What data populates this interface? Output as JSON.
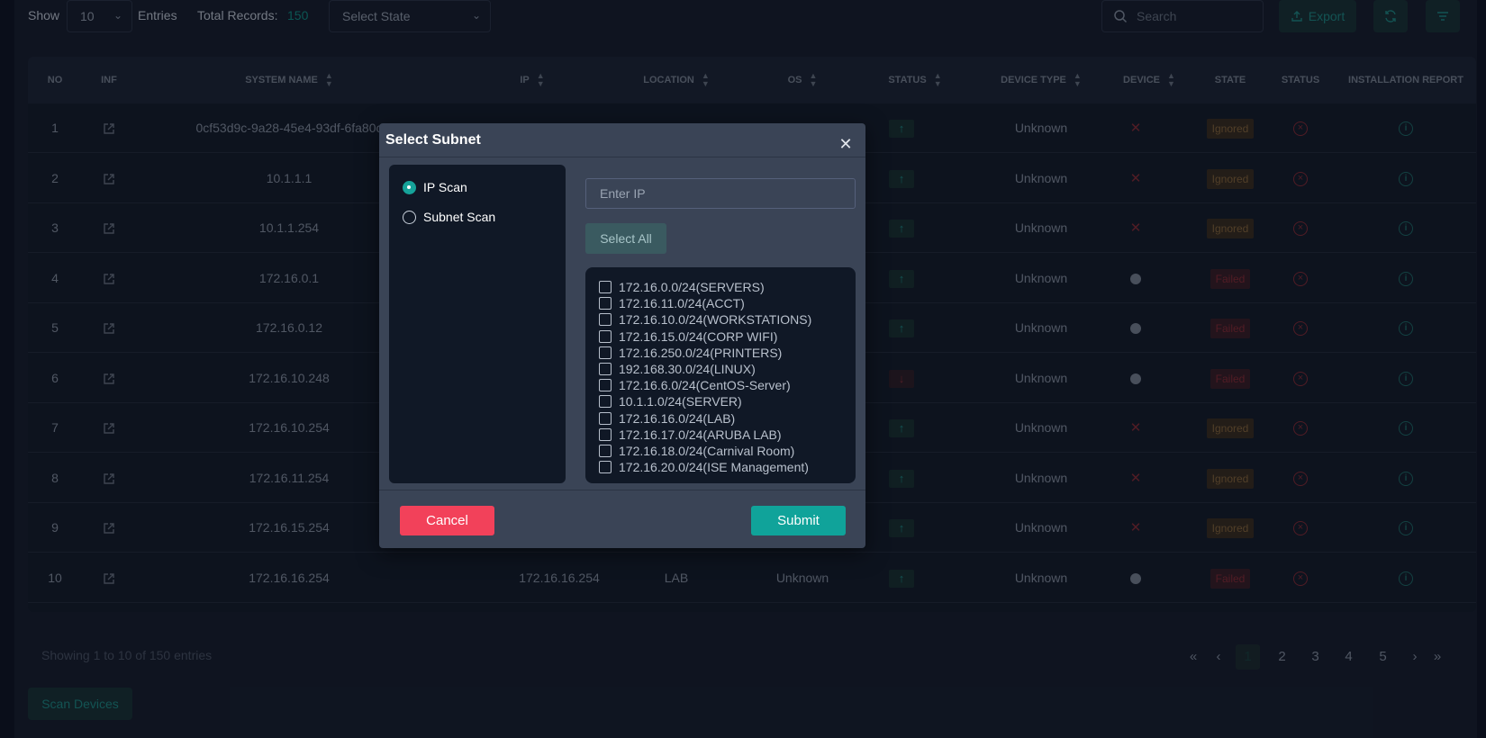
{
  "toolbar": {
    "show_label": "Show",
    "page_size": "10",
    "entries_label": "Entries",
    "total_label": "Total Records:",
    "total_value": "150",
    "state_placeholder": "Select State",
    "search_placeholder": "Search",
    "export_label": "Export",
    "icons": [
      "search-icon",
      "upload-icon",
      "refresh-icon",
      "filter-icon"
    ]
  },
  "table": {
    "columns": [
      "NO",
      "INF",
      "SYSTEM NAME",
      "IP",
      "LOCATION",
      "OS",
      "STATUS",
      "DEVICE TYPE",
      "DEVICE",
      "STATE",
      "STATUS",
      "INSTALLATION REPORT"
    ],
    "rows": [
      {
        "no": "1",
        "system_name": "0cf53d9c-9a28-45e4-93df-6fa80c",
        "ip": "",
        "location": "",
        "os": "",
        "status": "up",
        "device_type": "Unknown",
        "device": "x",
        "state": "Ignored"
      },
      {
        "no": "2",
        "system_name": "10.1.1.1",
        "ip": "",
        "location": "",
        "os": "",
        "status": "up",
        "device_type": "Unknown",
        "device": "x",
        "state": "Ignored"
      },
      {
        "no": "3",
        "system_name": "10.1.1.254",
        "ip": "",
        "location": "",
        "os": "",
        "status": "up",
        "device_type": "Unknown",
        "device": "x",
        "state": "Ignored"
      },
      {
        "no": "4",
        "system_name": "172.16.0.1",
        "ip": "",
        "location": "",
        "os": "",
        "status": "up",
        "device_type": "Unknown",
        "device": "dot",
        "state": "Failed"
      },
      {
        "no": "5",
        "system_name": "172.16.0.12",
        "ip": "",
        "location": "",
        "os": "",
        "status": "up",
        "device_type": "Unknown",
        "device": "dot",
        "state": "Failed"
      },
      {
        "no": "6",
        "system_name": "172.16.10.248",
        "ip": "",
        "location": "",
        "os": "",
        "status": "down",
        "device_type": "Unknown",
        "device": "dot",
        "state": "Failed"
      },
      {
        "no": "7",
        "system_name": "172.16.10.254",
        "ip": "",
        "location": "",
        "os": "",
        "status": "up",
        "device_type": "Unknown",
        "device": "x",
        "state": "Ignored"
      },
      {
        "no": "8",
        "system_name": "172.16.11.254",
        "ip": "",
        "location": "",
        "os": "",
        "status": "up",
        "device_type": "Unknown",
        "device": "x",
        "state": "Ignored"
      },
      {
        "no": "9",
        "system_name": "172.16.15.254",
        "ip": "",
        "location": "",
        "os": "",
        "status": "up",
        "device_type": "Unknown",
        "device": "x",
        "state": "Ignored"
      },
      {
        "no": "10",
        "system_name": "172.16.16.254",
        "ip": "172.16.16.254",
        "location": "LAB",
        "os": "Unknown",
        "status": "up",
        "device_type": "Unknown",
        "device": "dot",
        "state": "Failed"
      }
    ]
  },
  "footer": {
    "showing_text": "Showing 1 to 10 of 150 entries",
    "pages": [
      "1",
      "2",
      "3",
      "4",
      "5"
    ],
    "active_page": "1",
    "nav": {
      "first": "«",
      "prev": "‹",
      "next": "›",
      "last": "»"
    },
    "scan_button": "Scan Devices"
  },
  "modal": {
    "title": "Select Subnet",
    "close_icon": "close-icon",
    "scan_options": [
      {
        "label": "IP Scan",
        "selected": true
      },
      {
        "label": "Subnet Scan",
        "selected": false
      }
    ],
    "ip_placeholder": "Enter IP",
    "select_all_label": "Select All",
    "subnets": [
      "172.16.0.0/24(SERVERS)",
      "172.16.11.0/24(ACCT)",
      "172.16.10.0/24(WORKSTATIONS)",
      "172.16.15.0/24(CORP WIFI)",
      "172.16.250.0/24(PRINTERS)",
      "192.168.30.0/24(LINUX)",
      "172.16.6.0/24(CentOS-Server)",
      "10.1.1.0/24(SERVER)",
      "172.16.16.0/24(LAB)",
      "172.16.17.0/24(ARUBA LAB)",
      "172.16.18.0/24(Carnival Room)",
      "172.16.20.0/24(ISE Management)"
    ],
    "cancel_label": "Cancel",
    "submit_label": "Submit"
  },
  "colors": {
    "accent": "#10a39a",
    "danger": "#f2415a",
    "background": "#141c2b",
    "modal_bg": "#3a4456"
  }
}
